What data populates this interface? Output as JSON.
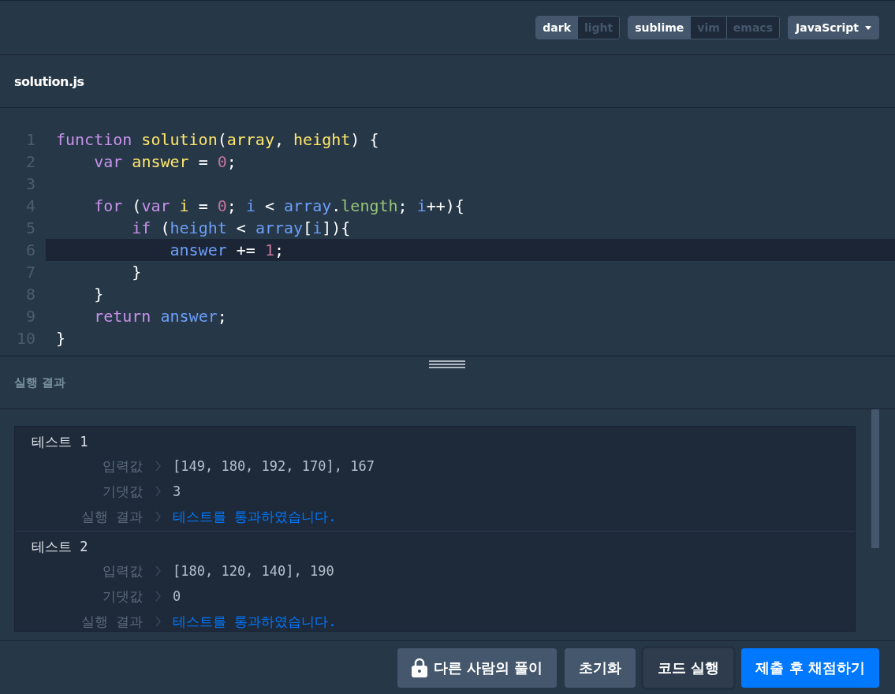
{
  "toolbar": {
    "groups": [
      {
        "options": [
          {
            "label": "dark",
            "selected": true
          },
          {
            "label": "light",
            "selected": false
          }
        ]
      },
      {
        "options": [
          {
            "label": "sublime",
            "selected": true
          },
          {
            "label": "vim",
            "selected": false
          },
          {
            "label": "emacs",
            "selected": false
          }
        ]
      }
    ],
    "language": "JavaScript"
  },
  "file": {
    "name": "solution.js"
  },
  "editor": {
    "lines": [
      {
        "number": "1",
        "active": false,
        "tokens": [
          {
            "text": "function",
            "kind": "keyword"
          },
          {
            "text": " solution",
            "kind": "def"
          },
          {
            "text": "(",
            "kind": "plain"
          },
          {
            "text": "array",
            "kind": "def"
          },
          {
            "text": ", ",
            "kind": "plain"
          },
          {
            "text": "height",
            "kind": "def"
          },
          {
            "text": ") {",
            "kind": "plain"
          }
        ]
      },
      {
        "number": "2",
        "active": false,
        "tokens": [
          {
            "text": "    var",
            "kind": "keyword"
          },
          {
            "text": " answer",
            "kind": "def"
          },
          {
            "text": " =",
            "kind": "plain"
          },
          {
            "text": " 0",
            "kind": "number"
          },
          {
            "text": ";",
            "kind": "plain"
          }
        ]
      },
      {
        "number": "3",
        "active": false
      },
      {
        "number": "4",
        "active": false,
        "tokens": [
          {
            "text": "    for",
            "kind": "keyword"
          },
          {
            "text": " (",
            "kind": "plain"
          },
          {
            "text": "var",
            "kind": "keyword"
          },
          {
            "text": " i",
            "kind": "def"
          },
          {
            "text": " =",
            "kind": "plain"
          },
          {
            "text": " 0",
            "kind": "number"
          },
          {
            "text": ";",
            "kind": "plain"
          },
          {
            "text": " i",
            "kind": "variable"
          },
          {
            "text": " <",
            "kind": "plain"
          },
          {
            "text": " array",
            "kind": "variable"
          },
          {
            "text": ".",
            "kind": "plain"
          },
          {
            "text": "length",
            "kind": "property"
          },
          {
            "text": ";",
            "kind": "plain"
          },
          {
            "text": " i",
            "kind": "variable"
          },
          {
            "text": "++){",
            "kind": "plain"
          }
        ]
      },
      {
        "number": "5",
        "active": false,
        "tokens": [
          {
            "text": "        if",
            "kind": "keyword"
          },
          {
            "text": " (",
            "kind": "plain"
          },
          {
            "text": "height",
            "kind": "variable"
          },
          {
            "text": " <",
            "kind": "plain"
          },
          {
            "text": " array",
            "kind": "variable"
          },
          {
            "text": "[",
            "kind": "plain"
          },
          {
            "text": "i",
            "kind": "variable"
          },
          {
            "text": "]){",
            "kind": "plain"
          }
        ]
      },
      {
        "number": "6",
        "active": true,
        "tokens": [
          {
            "text": "            answer",
            "kind": "variable"
          },
          {
            "text": " +=",
            "kind": "plain"
          },
          {
            "text": " 1",
            "kind": "number"
          },
          {
            "text": ";",
            "kind": "plain"
          }
        ]
      },
      {
        "number": "7",
        "active": false,
        "tokens": [
          {
            "text": "        }",
            "kind": "plain"
          }
        ]
      },
      {
        "number": "8",
        "active": false,
        "tokens": [
          {
            "text": "    }",
            "kind": "plain"
          }
        ]
      },
      {
        "number": "9",
        "active": false,
        "tokens": [
          {
            "text": "    return",
            "kind": "keyword"
          },
          {
            "text": " answer",
            "kind": "variable"
          },
          {
            "text": ";",
            "kind": "plain"
          }
        ]
      },
      {
        "number": "10",
        "active": false,
        "tokens": [
          {
            "text": "}",
            "kind": "plain"
          }
        ]
      }
    ]
  },
  "results": {
    "title": "실행 결과",
    "tests": [
      {
        "title": "테스트 1",
        "rows": [
          {
            "label": "입력값",
            "value": "[149, 180, 192, 170], 167",
            "kind": "value"
          },
          {
            "label": "기댓값",
            "value": "3",
            "kind": "value"
          },
          {
            "label": "실행 결과",
            "value": "테스트를 통과하였습니다.",
            "kind": "pass"
          }
        ]
      },
      {
        "title": "테스트 2",
        "rows": [
          {
            "label": "입력값",
            "value": "[180, 120, 140], 190",
            "kind": "value"
          },
          {
            "label": "기댓값",
            "value": "0",
            "kind": "value"
          },
          {
            "label": "실행 결과",
            "value": "테스트를 통과하였습니다.",
            "kind": "pass"
          }
        ]
      }
    ]
  },
  "buttons": [
    {
      "label": "다른 사람의 풀이",
      "kind": "lock"
    },
    {
      "label": "초기화",
      "kind": "secondary"
    },
    {
      "label": "코드 실행",
      "kind": "dark"
    },
    {
      "label": "제출 후 채점하기",
      "kind": "primary"
    }
  ]
}
